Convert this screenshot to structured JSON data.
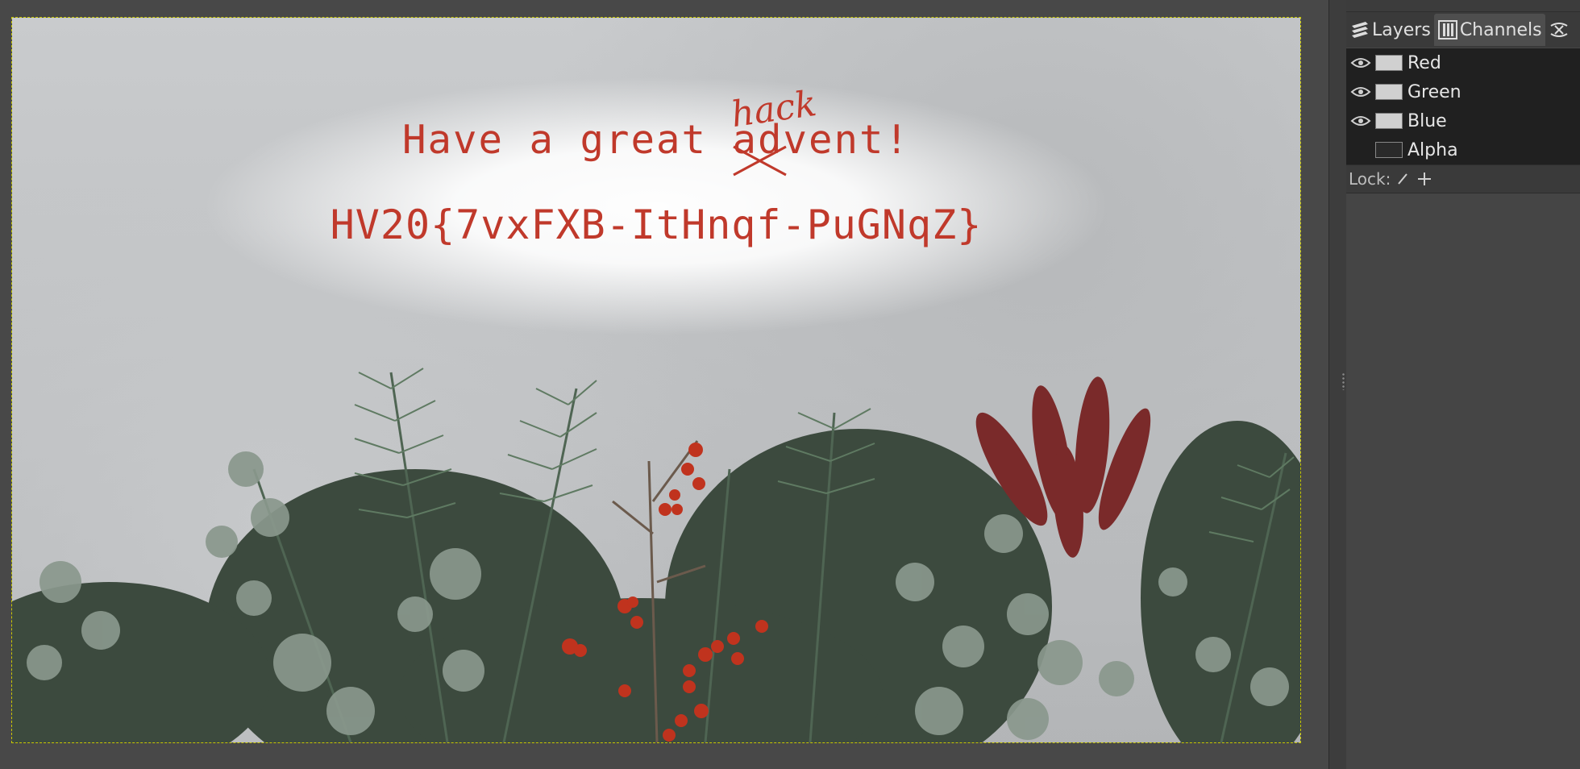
{
  "canvas": {
    "greeting_before": "Have a great ",
    "greeting_struck": "ad",
    "greeting_after": "vent!",
    "correction": "hack",
    "flag": "HV20{7vxFXB-ItHnqf-PuGNqZ}",
    "text_color": "#c0392b"
  },
  "panel": {
    "tabs": [
      {
        "label": "Layers",
        "icon": "layers-icon"
      },
      {
        "label": "Channels",
        "icon": "channels-icon"
      },
      {
        "label": "",
        "icon": "paths-icon"
      }
    ],
    "channels": [
      {
        "label": "Red",
        "visible": true
      },
      {
        "label": "Green",
        "visible": true
      },
      {
        "label": "Blue",
        "visible": true
      },
      {
        "label": "Alpha",
        "visible": false
      }
    ],
    "lock_label": "Lock:"
  }
}
